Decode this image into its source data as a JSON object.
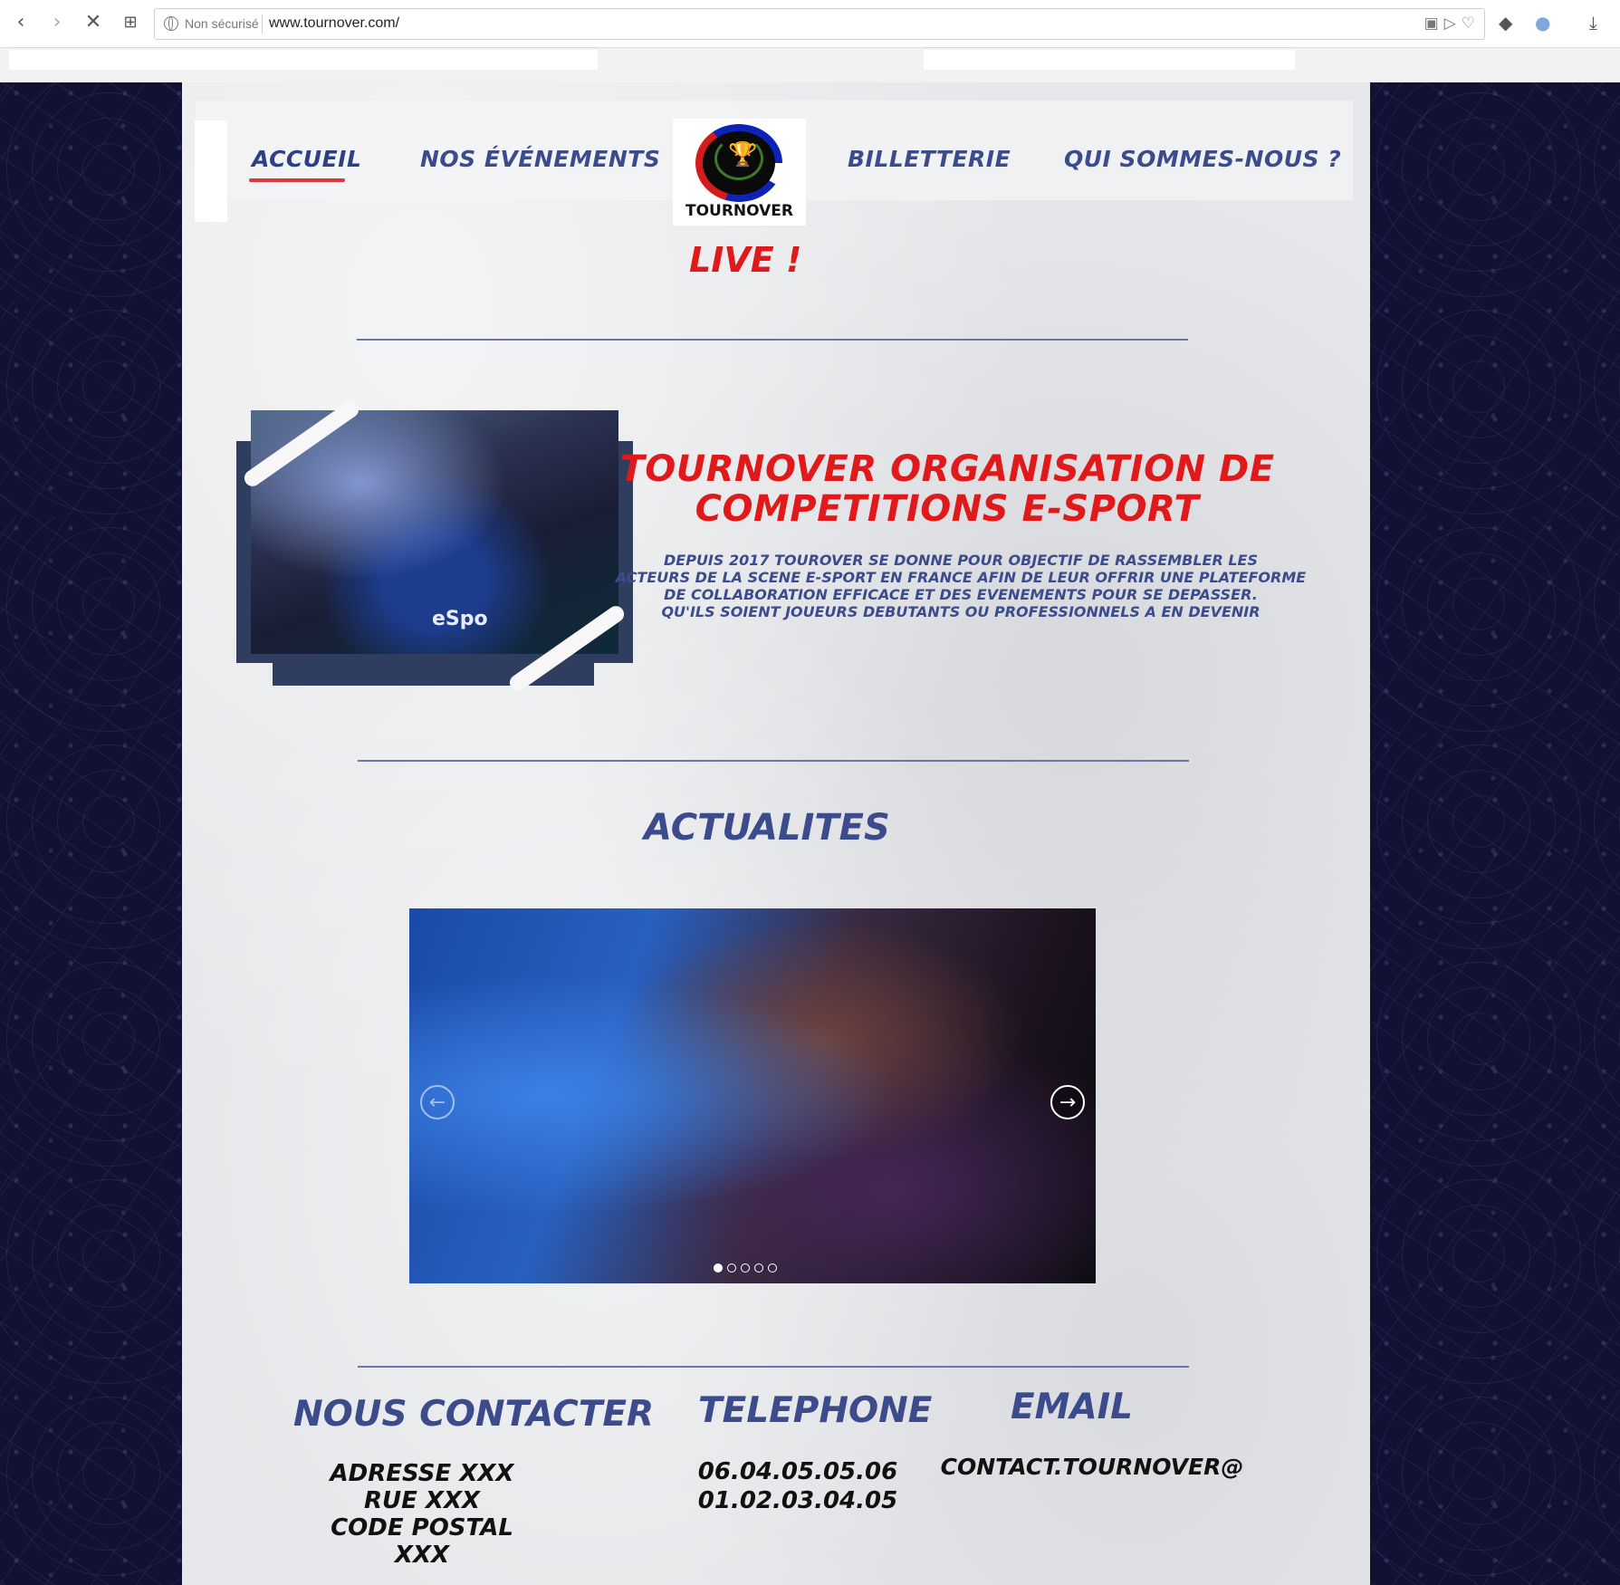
{
  "browser": {
    "security_label": "Non sécurisé",
    "url": "www.tournover.com/"
  },
  "nav": {
    "items": [
      {
        "label": "ACCUEIL"
      },
      {
        "label": "NOS ÉVÉNEMENTS"
      },
      {
        "label": "BILLETTERIE"
      },
      {
        "label": "QUI SOMMES-NOUS ?"
      }
    ],
    "logo_text": "TOURNOVER"
  },
  "live": {
    "label": "LIVE !"
  },
  "intro": {
    "photo_caption": "eSpo",
    "title_line1": "TOURNOVER ORGANISATION DE",
    "title_line2": "COMPETITIONS E-SPORT",
    "body_lines": [
      "DEPUIS 2017 TOUROVER SE DONNE POUR OBJECTIF DE RASSEMBLER LES",
      "ACTEURS DE LA SCENE E-SPORT EN FRANCE AFIN DE LEUR OFFRIR UNE PLATEFORME",
      "DE COLLABORATION EFFICACE ET DES EVENEMENTS POUR SE DEPASSER.",
      "QU'ILS SOIENT JOUEURS DEBUTANTS OU PROFESSIONNELS   A EN DEVENIR"
    ]
  },
  "news": {
    "title": "ACTUALITES",
    "carousel": {
      "slide_count": 5,
      "active_slide": 1
    }
  },
  "contact": {
    "title": "NOUS CONTACTER",
    "address_lines": [
      "ADRESSE XXX",
      "RUE XXX",
      "CODE POSTAL XXX"
    ],
    "phone_title": "TELEPHONE",
    "phone_lines": [
      "06.04.05.05.06",
      "01.02.03.04.05"
    ],
    "email_title": "EMAIL",
    "email": "CONTACT.TOURNOVER@"
  },
  "colors": {
    "accent_red": "#e01a1a",
    "nav_blue": "#3c4b8c",
    "side_navy": "#111233"
  }
}
